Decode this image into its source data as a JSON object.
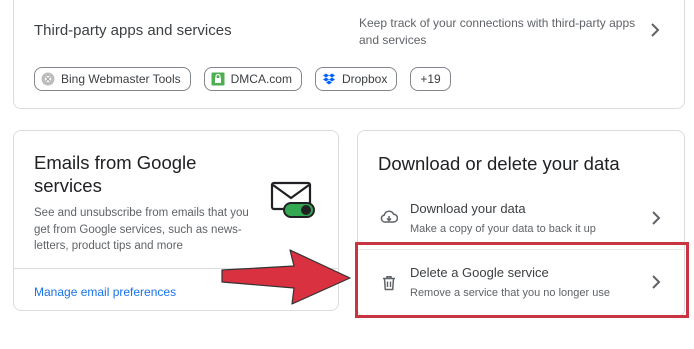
{
  "third_party": {
    "title": "Third-party apps and services",
    "description": "Keep track of your connections with third-party apps and services",
    "chips": [
      {
        "label": "Bing Webmaster Tools",
        "icon": "bing-icon"
      },
      {
        "label": "DMCA.com",
        "icon": "dmca-icon"
      },
      {
        "label": "Dropbox",
        "icon": "dropbox-icon"
      },
      {
        "label": "+19"
      }
    ]
  },
  "emails": {
    "title": "Emails from Google services",
    "description": "See and unsubscribe from emails that you get from Google services, such as news-letters, product tips and more",
    "link": "Manage email preferences"
  },
  "data": {
    "title": "Download or delete your data",
    "download": {
      "title": "Download your data",
      "subtitle": "Make a copy of your data to back it up",
      "icon": "cloud-download-icon"
    },
    "delete": {
      "title": "Delete a Google service",
      "subtitle": "Remove a service that you no longer use",
      "icon": "trash-icon"
    }
  },
  "colors": {
    "link": "#1a73e8",
    "highlight": "#c8343f",
    "arrow": "#d9313f",
    "toggle_on": "#1e8e3e"
  }
}
